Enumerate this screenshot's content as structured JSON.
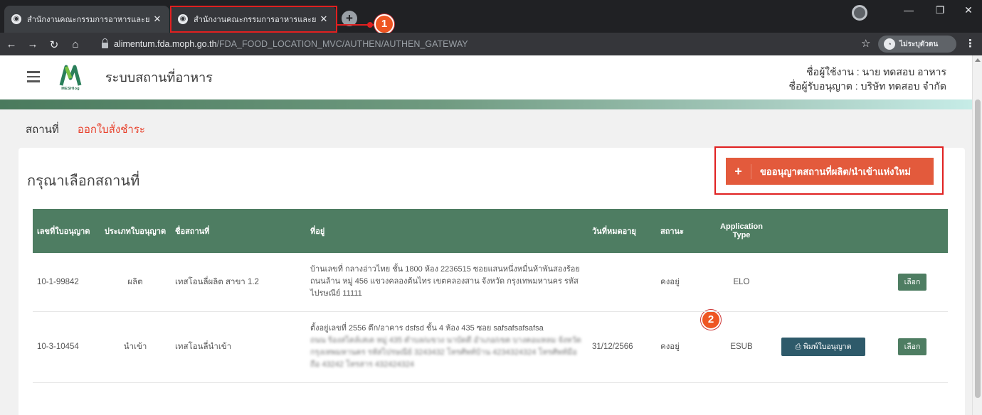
{
  "browser": {
    "tabs": [
      {
        "title": "สำนักงานคณะกรรมการอาหารและยา",
        "active": false
      },
      {
        "title": "สำนักงานคณะกรรมการอาหารและยา",
        "active": true
      }
    ],
    "new_tab_icon": "+",
    "url_host": "alimentum.fda.moph.go.th",
    "url_path": "/FDA_FOOD_LOCATION_MVC/AUTHEN/AUTHEN_GATEWAY",
    "profile_label": "ไม่ระบุตัวตน",
    "highlight_color": "#e02020"
  },
  "annotations": {
    "marker_1": "1",
    "marker_2": "2"
  },
  "app": {
    "logo_text": "MESHlog",
    "title": "ระบบสถานที่อาหาร",
    "user_line": "ชื่อผู้ใช้งาน : นาย ทดสอบ อาหาร",
    "licensee_line": "ชื่อผู้รับอนุญาต : บริษัท ทดสอบ จำกัด",
    "accent": "#4e7d62"
  },
  "subnav": {
    "item_location": "สถานที่",
    "item_invoice": "ออกใบสั่งชำระ"
  },
  "card": {
    "title": "กรุณาเลือกสถานที่",
    "new_button_label": "ขออนุญาตสถานที่ผลิต/นำเข้าแห่งใหม่",
    "new_button_icon": "+"
  },
  "table": {
    "headers": {
      "license_no": "เลขที่ใบอนุญาต",
      "license_type": "ประเภทใบอนุญาต",
      "place_name": "ชื่อสถานที่",
      "address": "ที่อยู่",
      "expiry": "วันที่หมดอายุ",
      "status": "สถานะ",
      "app_type": "Application Type"
    },
    "rows": [
      {
        "license_no": "10-1-99842",
        "license_type": "ผลิต",
        "place_name": "เทสโอนลี่ผลิต สาขา 1.2",
        "address": "บ้านเลขที่ กลางอ่าวไทย ชั้น 1800 ห้อง 2236515 ซอยแสนหนึ่งหมื่นห้าพันสองร้อย ถนนล้าน หมู่ 456 แขวงคลองต้นไทร เขตคลองสาน จังหวัด กรุงเทพมหานคร รหัสไปรษณีย์ 11111",
        "address_obscured": "",
        "expiry": "",
        "status": "คงอยู่",
        "app_type": "ELO",
        "print_label": "",
        "select_label": "เลือก"
      },
      {
        "license_no": "10-3-10454",
        "license_type": "นำเข้า",
        "place_name": "เทสโอนลี่นำเข้า",
        "address": "ตั้งอยู่เลขที่ 2556 ตึก/อาคาร dsfsd ชั้น 4 ห้อง 435 ซอย safsafsafsafsa",
        "address_obscured": "ถนน ร้องสไตล์เสเต หมู่ 435 ตำบล/แขวง นาบัดดี อำเภอ/เขต บางคอแหลม จังหวัด กรุงเทพมหานคร รหัสไปรษณีย์ 3243432 โทรศัพท์บ้าน 4234324324 โทรศัพท์มือถือ 43242 โทรสาร 432424324",
        "expiry": "31/12/2566",
        "status": "คงอยู่",
        "app_type": "ESUB",
        "print_label": "พิมพ์ใบอนุญาต",
        "select_label": "เลือก"
      }
    ]
  },
  "colors": {
    "header_green": "#4e7d62",
    "action_red": "#e35a3c",
    "link_red": "#e8412c",
    "print_blue": "#2e5a6a"
  }
}
